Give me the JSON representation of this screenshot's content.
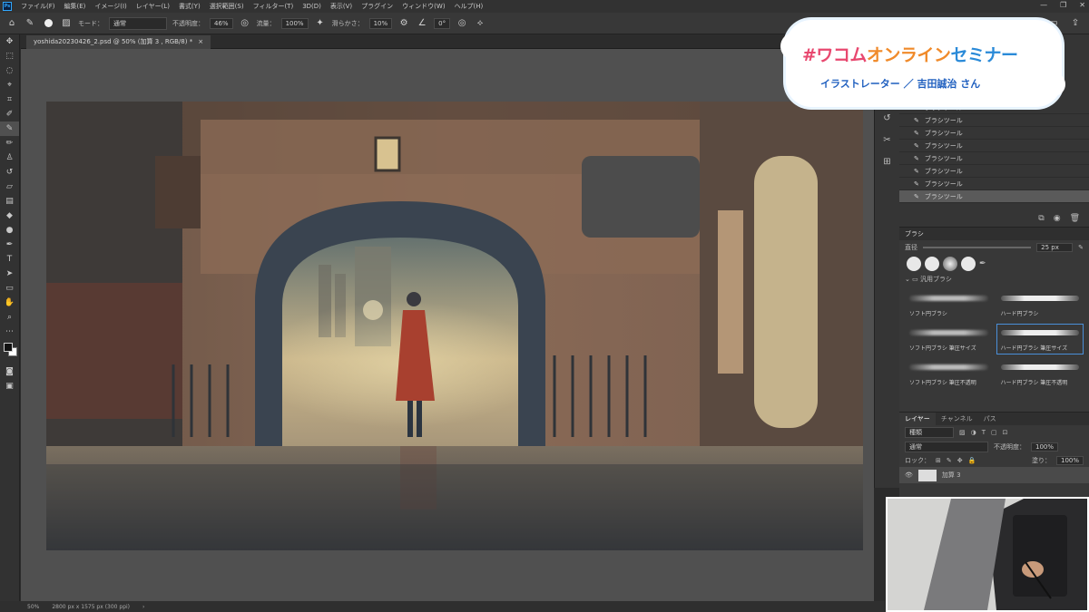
{
  "menubar": {
    "items": [
      "ファイル(F)",
      "編集(E)",
      "イメージ(I)",
      "レイヤー(L)",
      "書式(Y)",
      "選択範囲(S)",
      "フィルター(T)",
      "3D(D)",
      "表示(V)",
      "プラグイン",
      "ウィンドウ(W)",
      "ヘルプ(H)"
    ]
  },
  "options": {
    "mode_label": "モード：",
    "mode_value": "通常",
    "opacity_label": "不透明度：",
    "opacity_value": "46%",
    "flow_label": "流量：",
    "flow_value": "100%",
    "smooth_label": "滑らかさ：",
    "smooth_value": "10%",
    "angle_value": "0°"
  },
  "document": {
    "tab_title": "yoshida20230426_2.psd @ 50% (加算 3 , RGB/8) *",
    "close_glyph": "×"
  },
  "status": {
    "zoom": "50%",
    "dimensions": "2800 px x 1575 px (300 ppi)",
    "arrow": "›"
  },
  "history": {
    "items": [
      "ブラシツール",
      "ブラシツール",
      "ブラシツール",
      "ブラシツール",
      "ブラシツール",
      "ブラシツール",
      "ブラシツール",
      "ブラシツール"
    ],
    "selected_index": 7
  },
  "brushes": {
    "panel_title": "ブラシ",
    "size_label": "直径",
    "size_value": "25 px",
    "folder_label": "汎用ブラシ",
    "presets": [
      {
        "label": "ソフト円ブラシ",
        "soft": true
      },
      {
        "label": "ハード円ブラシ",
        "soft": false
      },
      {
        "label": "ソフト円ブラシ 筆圧サイズ",
        "soft": true
      },
      {
        "label": "ハード円ブラシ 筆圧サイズ",
        "soft": false
      },
      {
        "label": "ソフト円ブラシ 筆圧不透明",
        "soft": true
      },
      {
        "label": "ハード円ブラシ 筆圧不透明",
        "soft": false
      }
    ],
    "selected_preset": 3
  },
  "layers": {
    "tabs": [
      "レイヤー",
      "チャンネル",
      "パス"
    ],
    "kind_label": "種類",
    "blend_mode": "通常",
    "opacity_label": "不透明度：",
    "opacity_value": "100%",
    "lock_label": "ロック：",
    "fill_label": "塗り：",
    "fill_value": "100%",
    "layer_name": "加算 3"
  },
  "banner": {
    "title_part1": "#ワコム",
    "title_part2": "オンライン",
    "title_part3": "セミナー",
    "subtitle": "イラストレーター ／ 吉田誠治 さん"
  },
  "colors": {
    "accent_pink": "#e8486f",
    "accent_blue": "#1f5fbf",
    "ps_blue": "#31a8ff"
  }
}
